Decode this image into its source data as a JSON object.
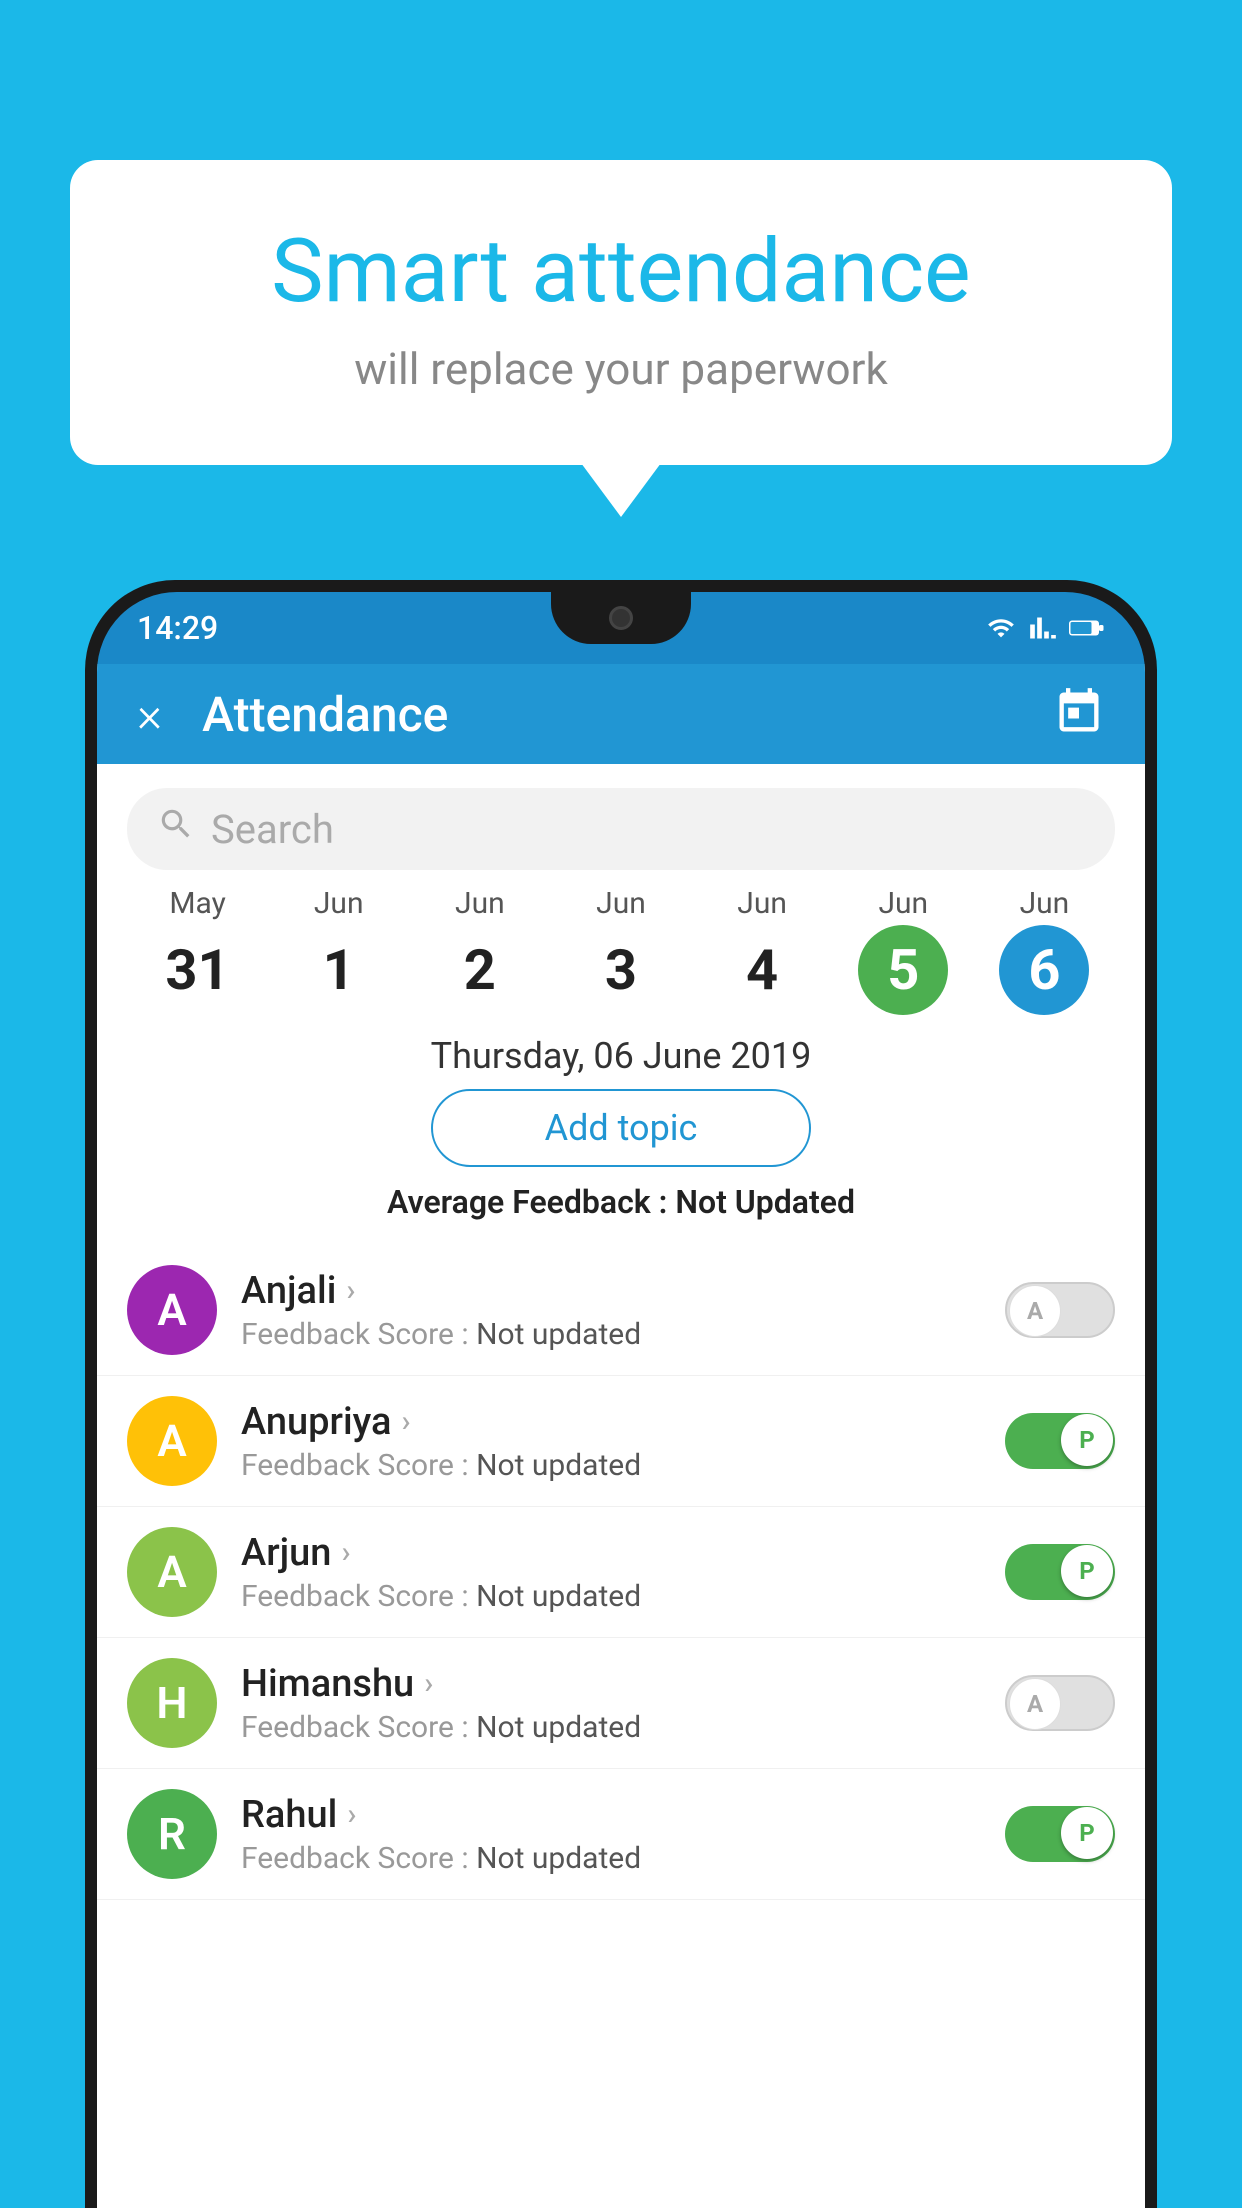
{
  "background_color": "#1BB8E8",
  "bubble": {
    "title": "Smart attendance",
    "subtitle": "will replace your paperwork"
  },
  "status_bar": {
    "time": "14:29"
  },
  "header": {
    "title": "Attendance",
    "close_label": "×"
  },
  "search": {
    "placeholder": "Search"
  },
  "calendar": {
    "months": [
      "May",
      "Jun",
      "Jun",
      "Jun",
      "Jun",
      "Jun",
      "Jun"
    ],
    "days": [
      "31",
      "1",
      "2",
      "3",
      "4",
      "5",
      "6"
    ],
    "today_index": 5,
    "selected_index": 6
  },
  "selected_date": "Thursday, 06 June 2019",
  "add_topic_label": "Add topic",
  "avg_feedback": {
    "label": "Average Feedback : ",
    "value": "Not Updated"
  },
  "students": [
    {
      "name": "Anjali",
      "avatar_letter": "A",
      "avatar_color": "#9C27B0",
      "feedback_label": "Feedback Score : ",
      "feedback_value": "Not updated",
      "toggle": "off",
      "toggle_letter": "A"
    },
    {
      "name": "Anupriya",
      "avatar_letter": "A",
      "avatar_color": "#FFC107",
      "feedback_label": "Feedback Score : ",
      "feedback_value": "Not updated",
      "toggle": "on",
      "toggle_letter": "P"
    },
    {
      "name": "Arjun",
      "avatar_letter": "A",
      "avatar_color": "#8BC34A",
      "feedback_label": "Feedback Score : ",
      "feedback_value": "Not updated",
      "toggle": "on",
      "toggle_letter": "P"
    },
    {
      "name": "Himanshu",
      "avatar_letter": "H",
      "avatar_color": "#8BC34A",
      "feedback_label": "Feedback Score : ",
      "feedback_value": "Not updated",
      "toggle": "off",
      "toggle_letter": "A"
    },
    {
      "name": "Rahul",
      "avatar_letter": "R",
      "avatar_color": "#4CAF50",
      "feedback_label": "Feedback Score : ",
      "feedback_value": "Not updated",
      "toggle": "on",
      "toggle_letter": "P"
    }
  ]
}
